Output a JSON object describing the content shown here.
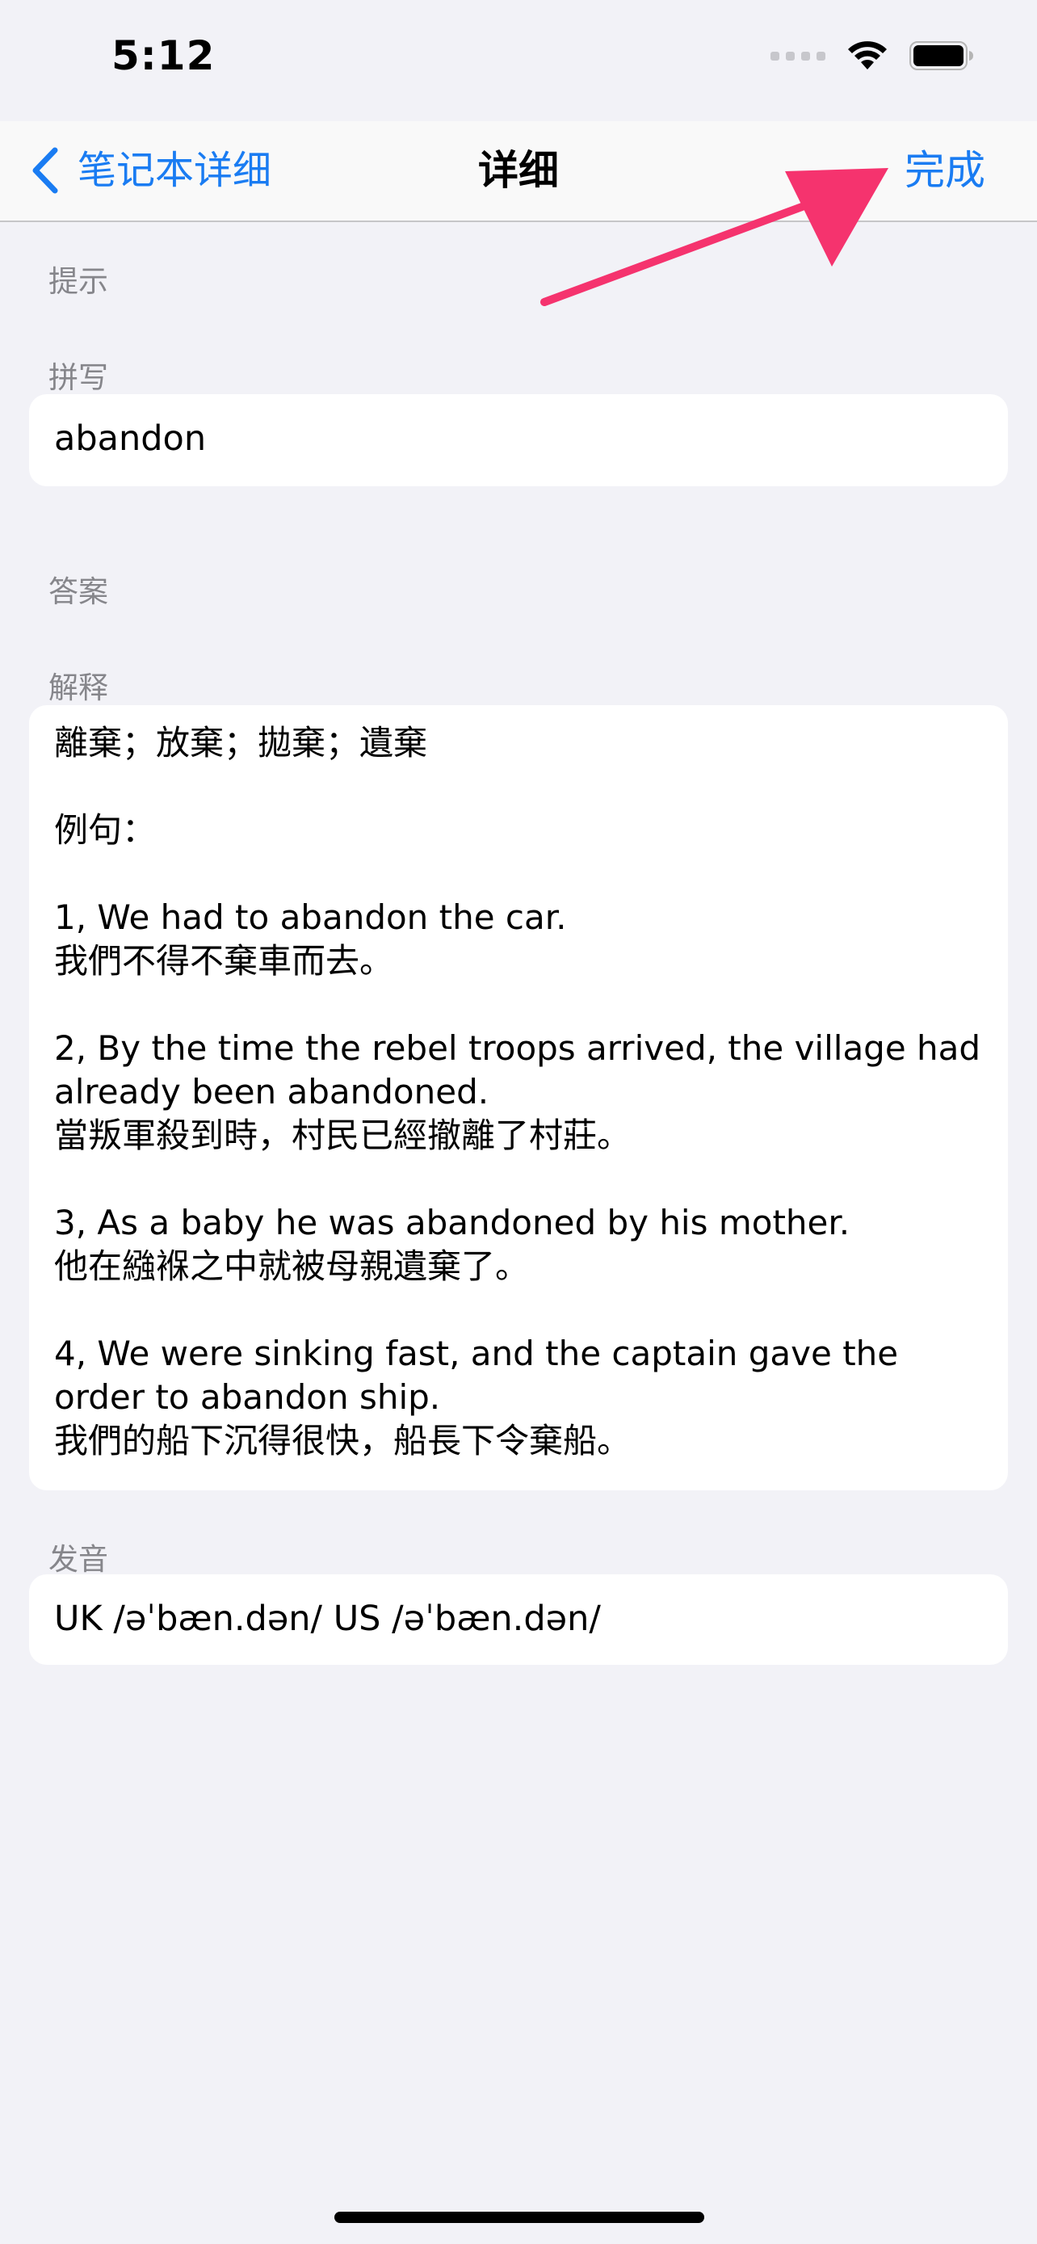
{
  "status_bar": {
    "time": "5:12"
  },
  "nav": {
    "back_label": "笔记本详细",
    "title": "详细",
    "done_label": "完成"
  },
  "sections": {
    "hint_header": "提示",
    "spelling_header": "拼写",
    "spelling_value": "abandon",
    "answer_header": "答案",
    "explanation_header": "解释",
    "explanation_value": "離棄；放棄；拋棄；遺棄\n\n例句：\n\n1, We had to abandon the car.\n我們不得不棄車而去。\n\n2, By the time the rebel troops arrived, the village had already been abandoned.\n當叛軍殺到時，村民已經撤離了村莊。\n\n3, As a baby he was abandoned by his mother.\n他在繈褓之中就被母親遺棄了。\n\n4, We were sinking fast, and the captain gave the order to abandon ship.\n我們的船下沉得很快，船長下令棄船。",
    "pronunciation_header": "发音",
    "pronunciation_value": "UK  /əˈbæn.dən/ US  /əˈbæn.dən/"
  },
  "colors": {
    "accent": "#1a7cf2",
    "annotation_arrow": "#f5336e",
    "background": "#f2f2f7",
    "secondary_text": "#86868b"
  }
}
